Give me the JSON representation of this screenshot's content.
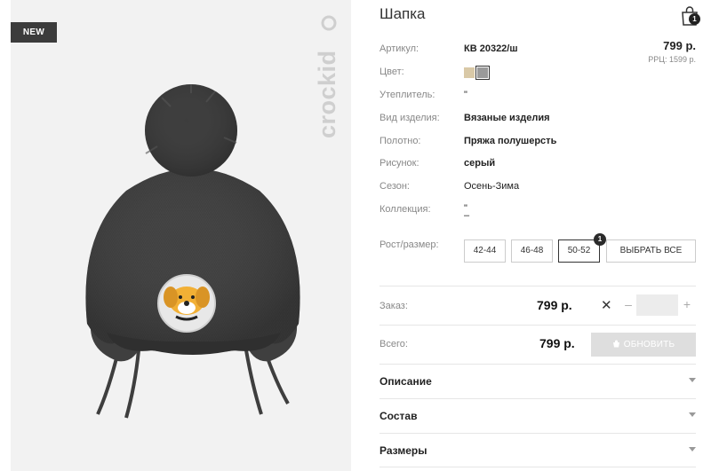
{
  "product": {
    "badge": "NEW",
    "brand": "crockid",
    "title": "Шапка"
  },
  "cart": {
    "icon": "shopping-bag-icon",
    "count": "1"
  },
  "details": [
    {
      "label": "Артикул:",
      "value": "КВ 20322/ш"
    },
    {
      "label": "Цвет:",
      "value": ""
    },
    {
      "label": "Утеплитель:",
      "value": "\""
    },
    {
      "label": "Вид изделия:",
      "value": "Вязаные изделия"
    },
    {
      "label": "Полотно:",
      "value": "Пряжа полушерсть"
    },
    {
      "label": "Рисунок:",
      "value": "серый"
    },
    {
      "label": "Сезон:",
      "value": "Осень-Зима"
    },
    {
      "label": "Коллекция:",
      "value": "\"\n–"
    }
  ],
  "price": {
    "value": "799 р.",
    "rrp": "РРЦ: 1599 р."
  },
  "colors": [
    "#d9c9a7",
    "#9a9a9a"
  ],
  "sizes": {
    "label": "Рост/размер:",
    "options": [
      "42-44",
      "46-48",
      "50-52"
    ],
    "selected_badge": "1",
    "select_all": "ВЫБРАТЬ ВСЕ"
  },
  "order": {
    "label": "Заказ:",
    "price": "799 р.",
    "x": "✕",
    "minus": "–",
    "plus": "+",
    "quantity": ""
  },
  "total": {
    "label": "Всего:",
    "price": "799 р.",
    "update_button": "ОБНОВИТЬ"
  },
  "accordion": [
    "Описание",
    "Состав",
    "Размеры"
  ]
}
